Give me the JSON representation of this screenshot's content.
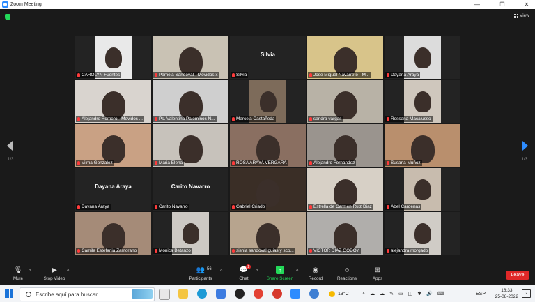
{
  "window": {
    "title": "Zoom Meeting"
  },
  "view": {
    "label": "View"
  },
  "pages": {
    "left": "1/3",
    "right": "1/3"
  },
  "tiles": [
    {
      "name": "CAROLYN Fuentes",
      "bg": "#e9e9e9",
      "cam": true
    },
    {
      "name": "Pamela Sandoval - Movidos x",
      "bg": "#c9c2b4",
      "cam": true,
      "active": true
    },
    {
      "name": "Silvia",
      "bg": "#232323",
      "cam": false,
      "big": "Silvia"
    },
    {
      "name": "Jose Miguel Navarrete - M...",
      "bg": "#d8c48a",
      "cam": true
    },
    {
      "name": "Dayana Araya",
      "bg": "#dcdcdc",
      "cam": true
    },
    {
      "name": "Alejandro Romero - Movidos ...",
      "bg": "#d9d4cf",
      "cam": true
    },
    {
      "name": "Ps. Valentina Palominos N...",
      "bg": "#cfcfcf",
      "cam": true
    },
    {
      "name": "Marcela Castañeda",
      "bg": "#7d6b5a",
      "cam": true
    },
    {
      "name": "sandra vargas",
      "bg": "#b8b2a6",
      "cam": true
    },
    {
      "name": "Rossana Macalusso",
      "bg": "#cfc7bd",
      "cam": true
    },
    {
      "name": "Vilma Gonzalez",
      "bg": "#c9a184",
      "cam": true
    },
    {
      "name": "Maria Elena",
      "bg": "#c7c2bb",
      "cam": true
    },
    {
      "name": "ROSA ARAYA VERGARA",
      "bg": "#8a6f61",
      "cam": true
    },
    {
      "name": "Alejandro Fernandez",
      "bg": "#9a948e",
      "cam": true
    },
    {
      "name": "Susana Muñoz",
      "bg": "#b98f6d",
      "cam": true
    },
    {
      "name": "Dayana Araya",
      "bg": "#232323",
      "cam": false,
      "big": "Dayana Araya"
    },
    {
      "name": "Carito Navarro",
      "bg": "#232323",
      "cam": false,
      "big": "Carito Navarro"
    },
    {
      "name": "Gabriel Criado",
      "bg": "#3a2e26",
      "cam": true
    },
    {
      "name": "Estrella de Carmen Ruiz Diaz",
      "bg": "#d7d0c6",
      "cam": true
    },
    {
      "name": "Abel Cardenas",
      "bg": "#c8bcae",
      "cam": true
    },
    {
      "name": "Camila Estefania Zamorano",
      "bg": "#a58b78",
      "cam": true
    },
    {
      "name": "Mónica Betanzo",
      "bg": "#cdc9c4",
      "cam": true
    },
    {
      "name": "sisnia sandoval guias y sco...",
      "bg": "#b7a48e",
      "cam": true
    },
    {
      "name": "VICTOR DIAZ GODOY",
      "bg": "#b0aeab",
      "cam": true
    },
    {
      "name": "alejandra morgado",
      "bg": "#d0ccc6",
      "cam": true
    }
  ],
  "toolbar": {
    "mute": "Mute",
    "stop_video": "Stop Video",
    "participants": "Participants",
    "participants_count": "56",
    "chat": "Chat",
    "chat_badge": "1",
    "share": "Share Screen",
    "record": "Record",
    "reactions": "Reactions",
    "apps": "Apps",
    "leave": "Leave"
  },
  "taskbar": {
    "search_placeholder": "Escribe aquí para buscar",
    "temperature": "13°C",
    "language": "ESP",
    "time": "18:33",
    "date": "25-08-2022",
    "notifications": "2"
  },
  "colors": {
    "accent": "#2d8cff",
    "leave": "#e02828",
    "share": "#23d959",
    "active_speaker": "#a6e22e"
  }
}
